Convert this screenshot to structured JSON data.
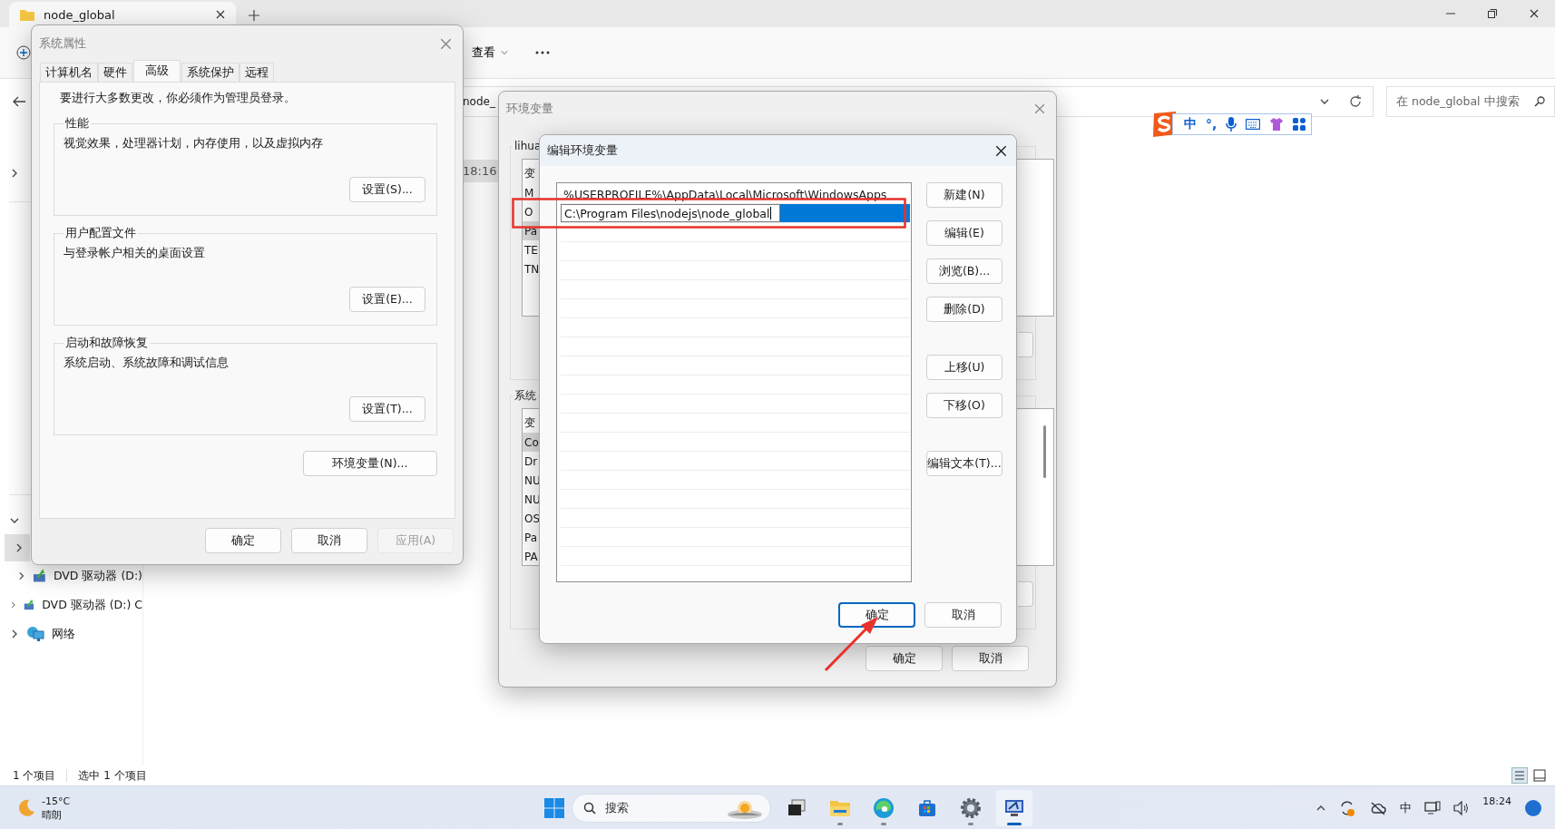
{
  "explorer": {
    "tab": {
      "title": "node_global"
    },
    "toolbar": {
      "view_label": "查看"
    },
    "address": {
      "text": "node_"
    },
    "search": {
      "placeholder": "在 node_global 中搜索"
    },
    "file_row": {
      "time": "18:16"
    },
    "sidebar": {
      "items": [
        {
          "selected": true,
          "children": [
            {
              "label": "DVD 驱动器 (D:)",
              "kind": "dvd",
              "selected": false
            }
          ]
        },
        {
          "label": "DVD 驱动器 (D:) C",
          "kind": "dvd",
          "selected": false
        },
        {
          "label": "网络",
          "kind": "network",
          "selected": false
        }
      ]
    },
    "status_bar": {
      "count": "1 个项目",
      "selection": "选中 1 个项目"
    }
  },
  "ime_bar": {
    "mode": "中",
    "punctuation": "°,"
  },
  "system_properties": {
    "title": "系统属性",
    "tabs": [
      {
        "label": "计算机名",
        "selected": false
      },
      {
        "label": "硬件",
        "selected": false
      },
      {
        "label": "高级",
        "selected": true
      },
      {
        "label": "系统保护",
        "selected": false
      },
      {
        "label": "远程",
        "selected": false
      }
    ],
    "notice": "要进行大多数更改，你必须作为管理员登录。",
    "groups": [
      {
        "title": "性能",
        "description": "视觉效果，处理器计划，内存使用，以及虚拟内存",
        "button": "设置(S)..."
      },
      {
        "title": "用户配置文件",
        "description": "与登录帐户相关的桌面设置",
        "button": "设置(E)..."
      },
      {
        "title": "启动和故障恢复",
        "description": "系统启动、系统故障和调试信息",
        "button": "设置(T)..."
      }
    ],
    "env_button": "环境变量(N)...",
    "buttons": [
      {
        "label": "确定",
        "disabled": false
      },
      {
        "label": "取消",
        "disabled": false
      },
      {
        "label": "应用(A)",
        "disabled": true
      }
    ]
  },
  "env_vars": {
    "title": "环境变量",
    "user_group": {
      "title": "lihua",
      "header": "变",
      "rows": [
        {
          "name": "M",
          "selected": false
        },
        {
          "name": "O",
          "selected": false
        },
        {
          "name": "Pa",
          "selected": true
        },
        {
          "name": "TE",
          "selected": false
        },
        {
          "name": "TN",
          "selected": false
        }
      ]
    },
    "system_group": {
      "title": "系统",
      "header": "变",
      "rows": [
        {
          "name": "Co",
          "selected": true
        },
        {
          "name": "Dr",
          "selected": false
        },
        {
          "name": "NU",
          "selected": false
        },
        {
          "name": "NU",
          "selected": false
        },
        {
          "name": "OS",
          "selected": false
        },
        {
          "name": "Pa",
          "selected": false
        },
        {
          "name": "PA",
          "selected": false
        }
      ]
    },
    "buttons": [
      {
        "label": "确定"
      },
      {
        "label": "取消"
      }
    ]
  },
  "edit_env_var": {
    "title": "编辑环境变量",
    "entries": [
      {
        "text": "%USERPROFILE%\\AppData\\Local\\Microsoft\\WindowsApps",
        "selected": false,
        "editing": false
      },
      {
        "text": "C:\\Program Files\\nodejs\\node_global",
        "selected": true,
        "editing": true
      }
    ],
    "button_groups": [
      [
        {
          "label": "新建(N)"
        },
        {
          "label": "编辑(E)"
        },
        {
          "label": "浏览(B)..."
        },
        {
          "label": "删除(D)"
        }
      ],
      [
        {
          "label": "上移(U)"
        },
        {
          "label": "下移(O)"
        }
      ],
      [
        {
          "label": "编辑文本(T)..."
        }
      ]
    ],
    "buttons": [
      {
        "label": "确定",
        "default": true
      },
      {
        "label": "取消",
        "default": false
      }
    ]
  },
  "taskbar": {
    "weather": {
      "temperature": "-15°C",
      "condition": "晴朗"
    },
    "search": {
      "placeholder": "搜索"
    },
    "apps": [
      {
        "kind": "taskview",
        "running": false,
        "active": false
      },
      {
        "kind": "files",
        "running": true,
        "active": false
      },
      {
        "kind": "browser",
        "running": true,
        "active": false
      },
      {
        "kind": "store",
        "running": false,
        "active": false
      },
      {
        "kind": "settings",
        "running": true,
        "active": false
      },
      {
        "kind": "remote",
        "running": true,
        "active": true
      }
    ],
    "tray": {
      "ime": "中",
      "time": "18:24"
    }
  }
}
